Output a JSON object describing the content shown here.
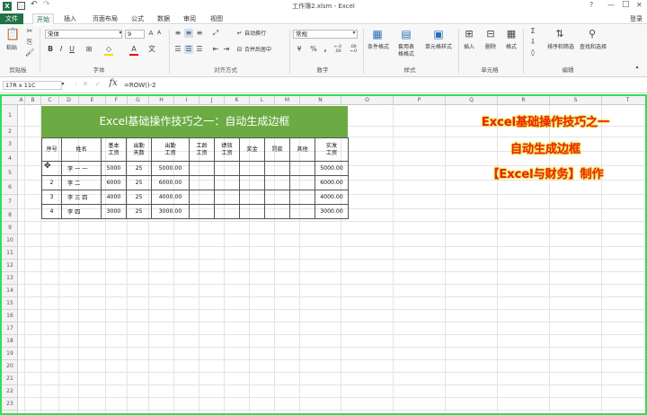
{
  "window": {
    "title": "工作簿2.xlsm - Excel",
    "controls": [
      "?",
      "—",
      "□",
      "✕"
    ],
    "login": "登录"
  },
  "menu": {
    "file": "文件",
    "tabs": [
      "开始",
      "插入",
      "页面布局",
      "公式",
      "数据",
      "审阅",
      "视图"
    ],
    "active_tab": "开始",
    "file_color": "#217346"
  },
  "ribbon": {
    "paste": "粘贴",
    "font_name": "宋体",
    "font_size": "9",
    "wrap_text": "自动换行",
    "merge_center": "合并后居中",
    "number_format": "常规",
    "percent": "%",
    "comma": ",",
    "dec_inc": "←.0 .00",
    "dec_dec": ".00 →.0",
    "conditional_format": "条件格式",
    "format_as_table": "套用表格格式",
    "cell_styles": "单元格样式",
    "insert": "插入",
    "delete": "删除",
    "format": "格式",
    "sort_filter": "排序和筛选",
    "find_select": "查找和选择",
    "groups": [
      "剪贴板",
      "字体",
      "对齐方式",
      "数字",
      "样式",
      "单元格",
      "编辑"
    ]
  },
  "formula_bar": {
    "name_box": "17R x 11C",
    "formula": "=ROW()-2"
  },
  "columns": [
    "A",
    "B",
    "C",
    "D",
    "E",
    "F",
    "G",
    "H",
    "I",
    "J",
    "K",
    "L",
    "M",
    "N",
    "O",
    "P",
    "Q",
    "R",
    "S",
    "T",
    "U"
  ],
  "rows": [
    "1",
    "2",
    "3",
    "4",
    "5",
    "6",
    "7",
    "8",
    "9",
    "10",
    "11",
    "12",
    "13",
    "14",
    "15",
    "16",
    "17",
    "18",
    "19",
    "20",
    "21",
    "22",
    "23",
    "24",
    "25"
  ],
  "sheet": {
    "banner_title": "Excel基础操作技巧之一：自动生成边框",
    "banner_color": "#6cab43",
    "headers": [
      "序号",
      "姓名",
      "基本\n工资",
      "出勤\n天数",
      "出勤\n工资",
      "工龄\n工资",
      "绩效\n工资",
      "奖金",
      "罚款",
      "其他",
      "实发\n工资"
    ],
    "rows": [
      [
        "",
        "李  一  一",
        "5000",
        "25",
        "5000.00",
        "",
        "",
        "",
        "",
        "",
        "5000.00"
      ],
      [
        "2",
        "李    二",
        "6000",
        "25",
        "6000.00",
        "",
        "",
        "",
        "",
        "",
        "6000.00"
      ],
      [
        "3",
        "李  三  四",
        "4000",
        "25",
        "4000.00",
        "",
        "",
        "",
        "",
        "",
        "4000.00"
      ],
      [
        "4",
        "李    四",
        "3000",
        "25",
        "3000.00",
        "",
        "",
        "",
        "",
        "",
        "3000.00"
      ]
    ]
  },
  "overlay": {
    "line1": "Excel基础操作技巧之一",
    "line2": "自动生成边框",
    "line3": "【Excel与财务】制作",
    "color": "#ee2211",
    "glow": "#ffe400"
  },
  "selection_border_color": "#2ee05a"
}
